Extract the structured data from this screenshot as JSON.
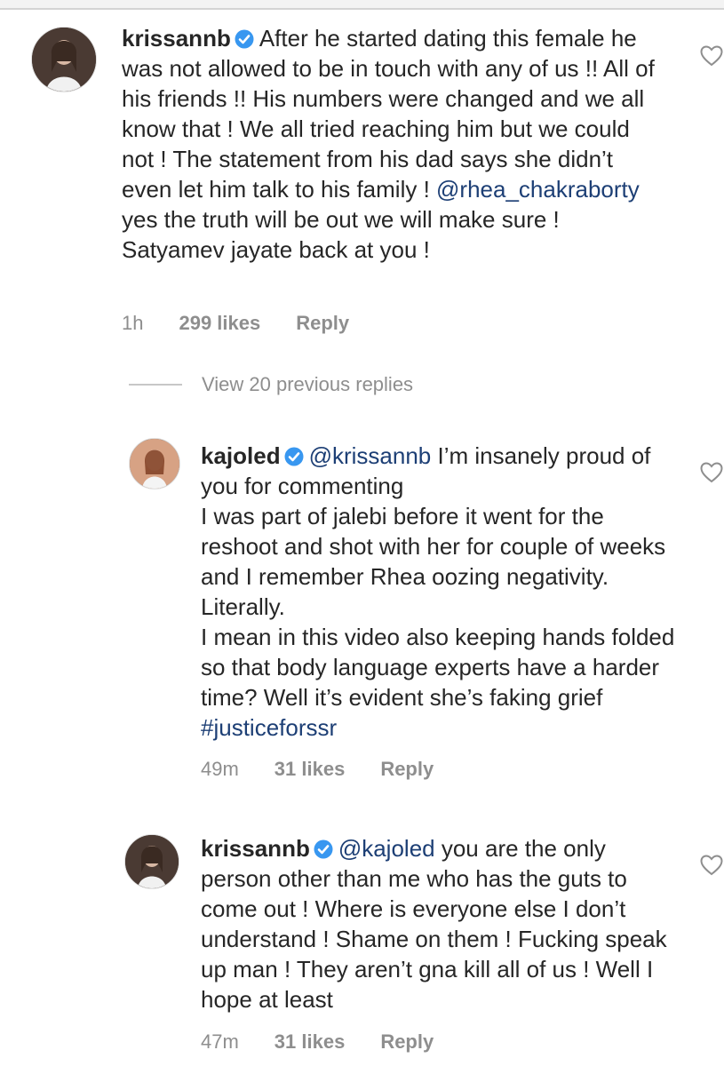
{
  "comments": [
    {
      "username": "krissannb",
      "text_before": "After he started dating this female he was not allowed to be in touch with any of us !! All of his friends !! His numbers were changed and we all know that ! We all tried reaching him but we could not ! The statement from his dad says she didn’t even let him talk to his family ! ",
      "mention": "@rhea_chakraborty",
      "text_after": " yes the truth will be out we will make sure ! Satyamev jayate back at you !",
      "time": "1h",
      "likes": "299 likes",
      "reply_label": "Reply"
    },
    {
      "username": "kajoled",
      "mention": "@krissannb",
      "text_line1": " I’m insanely proud of you for commenting",
      "text_line2": "I was part of jalebi before it went for the reshoot and shot with her for couple of weeks and I remember Rhea oozing negativity. Literally.",
      "text_line3": "I mean in this video also keeping hands folded so that body language experts have a harder time? Well it’s evident she’s faking grief ",
      "hashtag": "#justiceforssr",
      "time": "49m",
      "likes": "31 likes",
      "reply_label": "Reply"
    },
    {
      "username": "krissannb",
      "mention": "@kajoled",
      "text": " you are the only person other than me who has the guts to come out ! Where is everyone else I don’t understand ! Shame on them ! Fucking speak up man ! They aren’t gna kill all of us ! Well I hope at least",
      "time": "47m",
      "likes": "31 likes",
      "reply_label": "Reply"
    }
  ],
  "view_replies": "View 20 previous replies",
  "icons": {
    "verified": "verified-badge-icon",
    "heart": "heart-outline-icon"
  },
  "colors": {
    "mention": "#1d3f75",
    "verified": "#3897f0",
    "meta": "#8e8e8e"
  }
}
